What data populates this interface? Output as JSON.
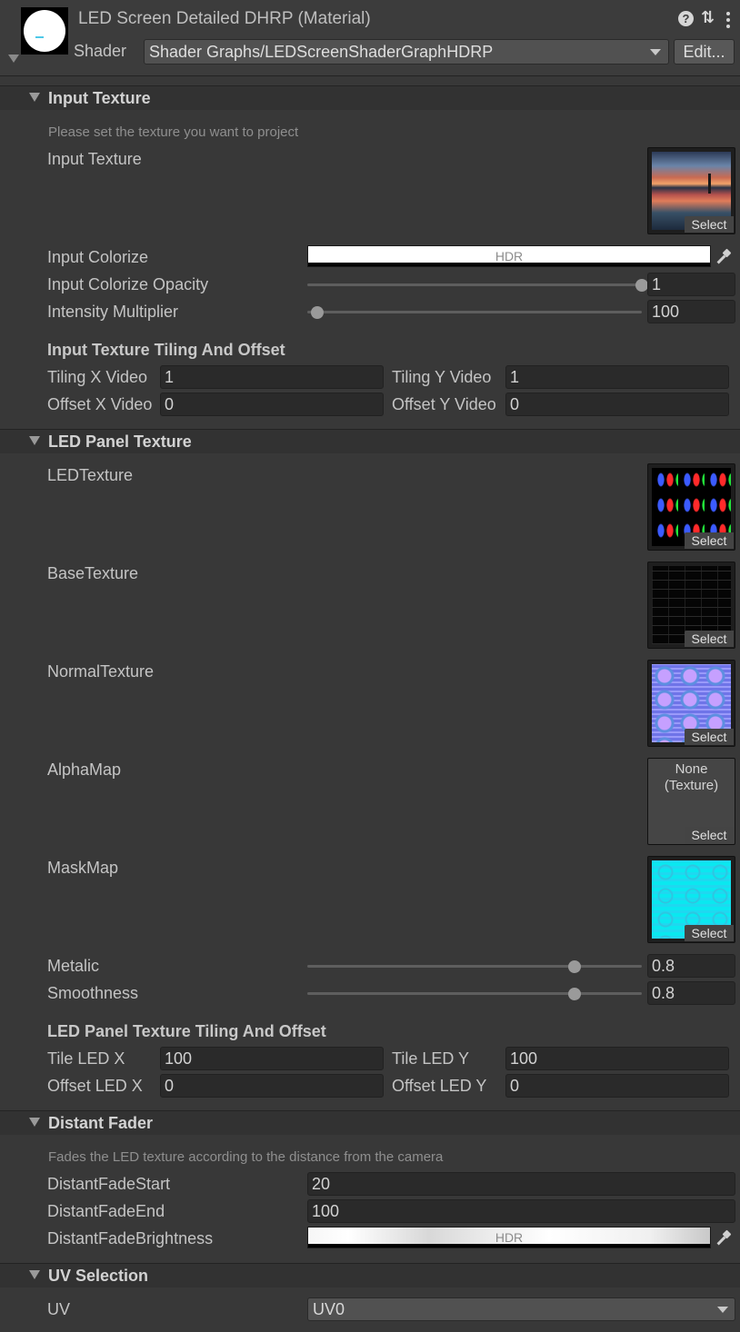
{
  "header": {
    "title": "LED Screen Detailed DHRP (Material)",
    "shader_label": "Shader",
    "shader_value": "Shader Graphs/LEDScreenShaderGraphHDRP",
    "edit_label": "Edit...",
    "help_glyph": "?",
    "settings_glyph": "⇅",
    "icons": [
      "material-preview-icon",
      "help-icon",
      "settings-icon",
      "kebab-menu-icon"
    ]
  },
  "input_texture": {
    "title": "Input Texture",
    "description": "Please set the texture you want to project",
    "texture_label": "Input Texture",
    "select_label": "Select",
    "colorize_label": "Input Colorize",
    "colorize_hdr": "HDR",
    "colorize_color": "#ffffff",
    "opacity_label": "Input Colorize Opacity",
    "opacity_value": "1",
    "opacity_fraction": 1.0,
    "intensity_label": "Intensity Multiplier",
    "intensity_value": "100",
    "intensity_fraction": 0.03,
    "tiling_title": "Input Texture Tiling And Offset",
    "tiling_x_label": "Tiling X Video",
    "tiling_x_value": "1",
    "tiling_y_label": "Tiling Y Video",
    "tiling_y_value": "1",
    "offset_x_label": "Offset X Video",
    "offset_x_value": "0",
    "offset_y_label": "Offset Y Video",
    "offset_y_value": "0"
  },
  "led_panel": {
    "title": "LED Panel Texture",
    "select_label": "Select",
    "textures": [
      {
        "label": "LEDTexture"
      },
      {
        "label": "BaseTexture"
      },
      {
        "label": "NormalTexture"
      },
      {
        "label": "AlphaMap",
        "none_text": "None (Texture)"
      },
      {
        "label": "MaskMap"
      }
    ],
    "metalic_label": "Metalic",
    "metalic_value": "0.8",
    "metalic_fraction": 0.8,
    "smoothness_label": "Smoothness",
    "smoothness_value": "0.8",
    "smoothness_fraction": 0.8,
    "tiling_title": "LED Panel Texture Tiling And Offset",
    "tile_x_label": "Tile LED X",
    "tile_x_value": "100",
    "tile_y_label": "Tile LED Y",
    "tile_y_value": "100",
    "offset_x_label": "Offset LED X",
    "offset_x_value": "0",
    "offset_y_label": "Offset LED Y",
    "offset_y_value": "0"
  },
  "distant_fader": {
    "title": "Distant Fader",
    "description": "Fades the LED texture according to the distance from the camera",
    "start_label": "DistantFadeStart",
    "start_value": "20",
    "end_label": "DistantFadeEnd",
    "end_value": "100",
    "brightness_label": "DistantFadeBrightness",
    "brightness_hdr": "HDR"
  },
  "uv_selection": {
    "title": "UV Selection",
    "uv_label": "UV",
    "uv_value": "UV0"
  }
}
